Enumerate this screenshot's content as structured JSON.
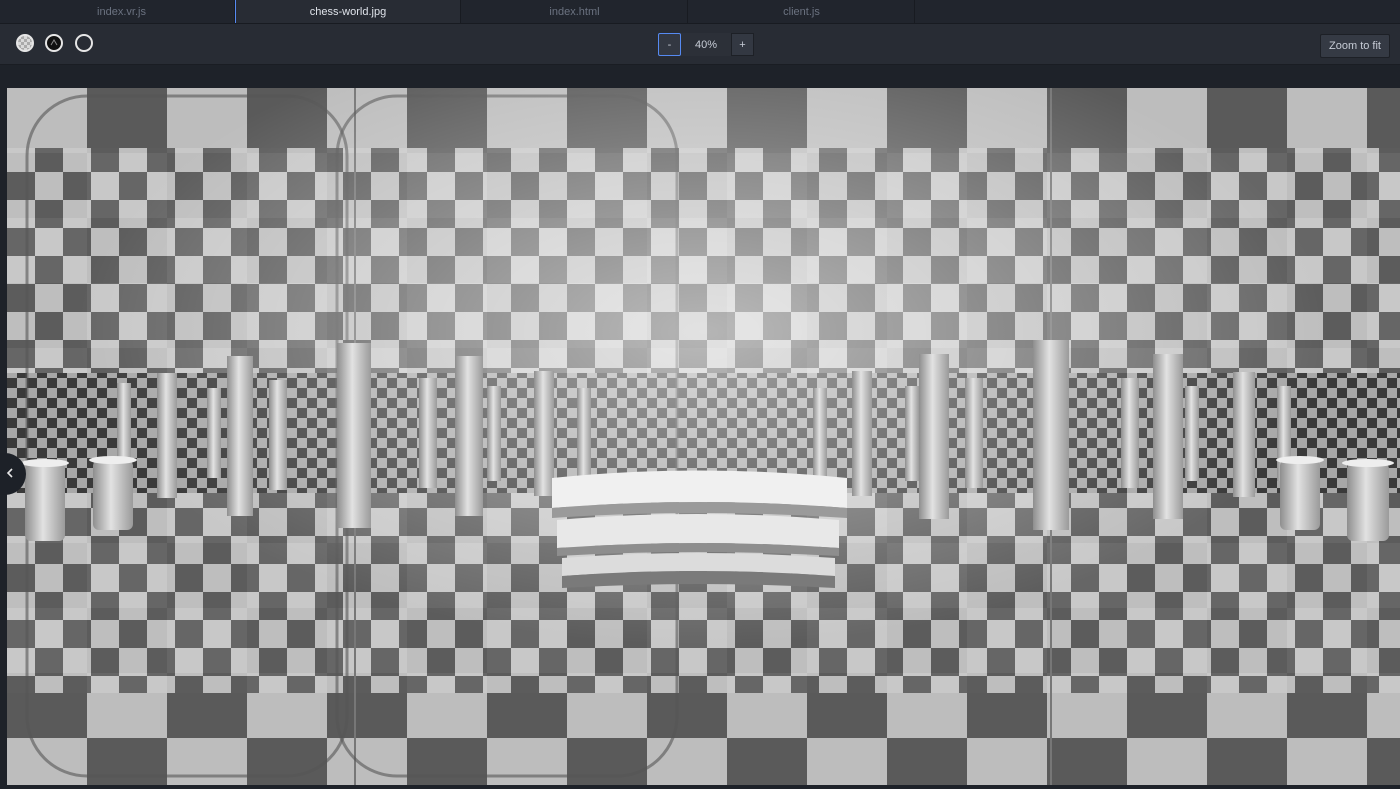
{
  "tabs": [
    {
      "label": "index.vr.js",
      "active": false
    },
    {
      "label": "chess-world.jpg",
      "active": true
    },
    {
      "label": "index.html",
      "active": false
    },
    {
      "label": "client.js",
      "active": false
    }
  ],
  "toolbar": {
    "backgrounds": [
      {
        "icon": "checker-background-icon"
      },
      {
        "icon": "dark-background-icon"
      },
      {
        "icon": "transparent-background-icon"
      }
    ],
    "zoom_out_label": "-",
    "zoom_value": "40%",
    "zoom_in_label": "+",
    "zoom_fit_label": "Zoom to fit"
  },
  "viewer": {
    "image_name": "chess-world.jpg",
    "collapse_icon": "chevron-left-icon"
  },
  "colors": {
    "accent": "#568af2",
    "tab_bg": "#21252d",
    "active_tab_bg": "#282c34",
    "panel_bg": "#1e2229"
  }
}
